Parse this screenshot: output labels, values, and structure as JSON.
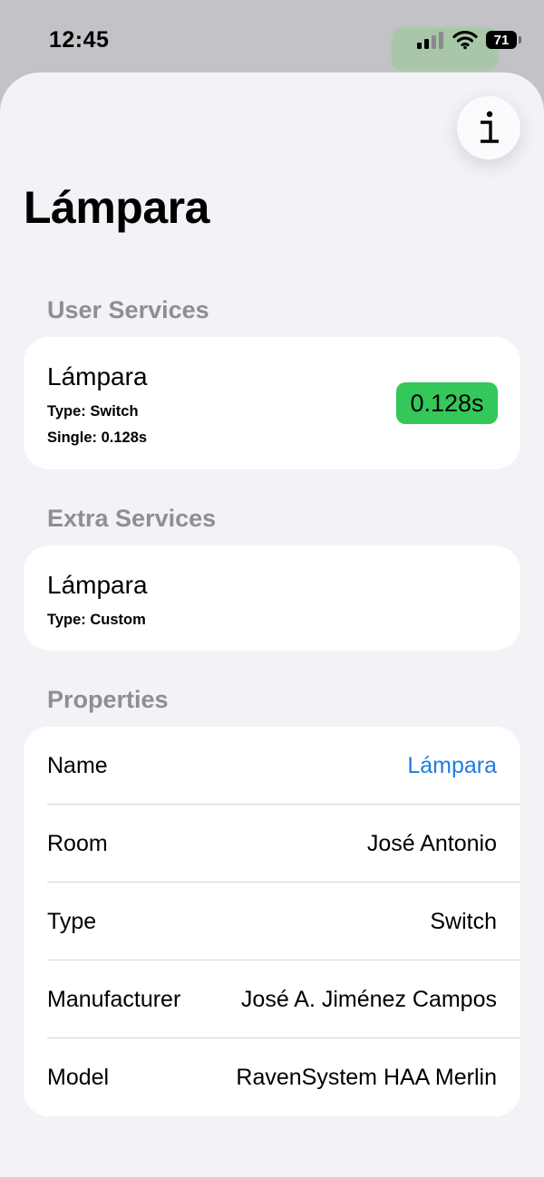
{
  "status_bar": {
    "time": "12:45",
    "battery_level": "71",
    "icons": [
      "cellular-signal-icon",
      "wifi-icon",
      "battery-icon"
    ]
  },
  "sheet": {
    "info_button_icon": "info-icon",
    "title": "Lámpara"
  },
  "user_services": {
    "header": "User Services",
    "items": [
      {
        "name": "Lámpara",
        "type_line": "Type: Switch",
        "detail_line": "Single: 0.128s",
        "time_badge": "0.128s",
        "badge_color": "#34c759"
      }
    ]
  },
  "extra_services": {
    "header": "Extra Services",
    "items": [
      {
        "name": "Lámpara",
        "type_line": "Type: Custom"
      }
    ]
  },
  "properties": {
    "header": "Properties",
    "rows": [
      {
        "label": "Name",
        "value": "Lámpara",
        "link_color": "#1f7ce0"
      },
      {
        "label": "Room",
        "value": "José Antonio"
      },
      {
        "label": "Type",
        "value": "Switch"
      },
      {
        "label": "Manufacturer",
        "value": "José A. Jiménez Campos"
      },
      {
        "label": "Model",
        "value": "RavenSystem HAA Merlin"
      }
    ]
  }
}
